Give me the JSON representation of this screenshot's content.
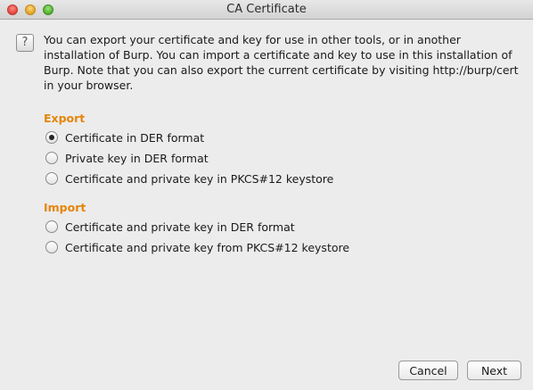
{
  "window": {
    "title": "CA Certificate"
  },
  "help": {
    "icon_glyph": "?",
    "description": "You can export your certificate and key for use in other tools, or in another installation of Burp. You can import a certificate and key to use in this installation of Burp. Note that you can also export the current certificate by visiting http://burp/cert in your browser."
  },
  "export": {
    "heading": "Export",
    "options": [
      {
        "label": "Certificate in DER format",
        "selected": true
      },
      {
        "label": "Private key in DER format",
        "selected": false
      },
      {
        "label": "Certificate and private key in PKCS#12 keystore",
        "selected": false
      }
    ]
  },
  "import": {
    "heading": "Import",
    "options": [
      {
        "label": "Certificate and private key in DER format",
        "selected": false
      },
      {
        "label": "Certificate and private key from PKCS#12 keystore",
        "selected": false
      }
    ]
  },
  "buttons": {
    "cancel": "Cancel",
    "next": "Next"
  },
  "colors": {
    "section_heading": "#e5850b",
    "window_background": "#ececec"
  }
}
